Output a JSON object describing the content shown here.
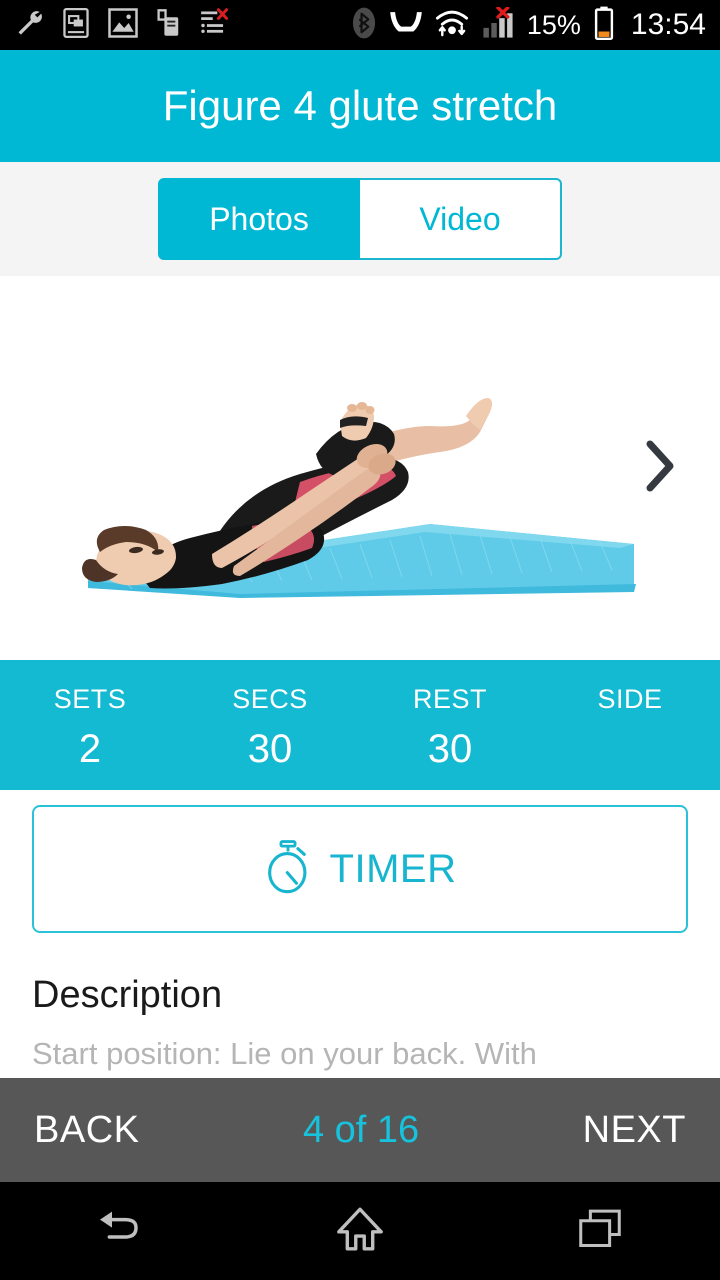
{
  "status_bar": {
    "left_icons": [
      {
        "name": "wrench-icon",
        "label": "wrench"
      },
      {
        "name": "screen-mirror-icon",
        "label": "screen-mirror"
      },
      {
        "name": "gallery-image-icon",
        "label": "gallery"
      },
      {
        "name": "usb-device-icon",
        "label": "usb-device"
      },
      {
        "name": "sync-error-icon",
        "label": "sync-error"
      }
    ],
    "right_icons": [
      {
        "name": "bluetooth-icon",
        "label": "bluetooth"
      },
      {
        "name": "vibrate-icon",
        "label": "vibrate"
      },
      {
        "name": "wifi-icon",
        "label": "wifi"
      },
      {
        "name": "signal-bars-icon",
        "label": "signal-no-service"
      }
    ],
    "battery_percent": "15%",
    "clock": "13:54"
  },
  "header": {
    "title": "Figure 4 glute stretch"
  },
  "tabs": {
    "items": [
      {
        "label": "Photos",
        "active": true
      },
      {
        "label": "Video",
        "active": false
      }
    ],
    "photos_label": "Photos",
    "video_label": "Video"
  },
  "photo": {
    "alt": "Woman lying on back on blue yoga mat performing figure 4 glute stretch",
    "next_icon": "chevron-right-icon"
  },
  "stats": [
    {
      "label": "SETS",
      "value": "2"
    },
    {
      "label": "SECS",
      "value": "30"
    },
    {
      "label": "REST",
      "value": "30"
    },
    {
      "label": "SIDE",
      "value": ""
    }
  ],
  "timer": {
    "label": "TIMER",
    "icon": "stopwatch-icon"
  },
  "description": {
    "heading": "Description",
    "body": "Start position: Lie on your back. With"
  },
  "bottom_nav": {
    "back_label": "BACK",
    "counter": "4 of 16",
    "next_label": "NEXT"
  },
  "system_nav": {
    "back_icon": "back-arrow-icon",
    "home_icon": "home-icon",
    "recents_icon": "recents-icon"
  },
  "colors": {
    "accent": "#00B8D4",
    "stats_bg": "#14B9D2",
    "bottom_bar": "#575757",
    "tab_strip_bg": "#F4F4F4",
    "counter_cyan": "#17C2DC",
    "description_text": "#B5B5B5"
  }
}
